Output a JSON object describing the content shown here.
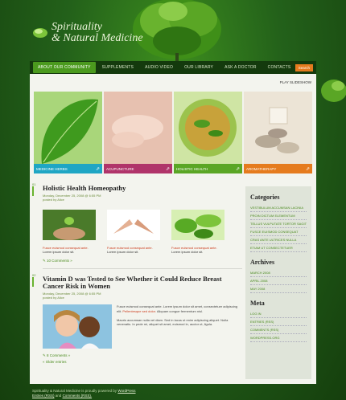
{
  "logo": {
    "line1": "Spirituality",
    "line2": "& Natural Medicine"
  },
  "nav": {
    "items": [
      {
        "label": "About Our Community",
        "active": true
      },
      {
        "label": "Supplements",
        "active": false
      },
      {
        "label": "Audio video",
        "active": false
      },
      {
        "label": "Our library",
        "active": false
      },
      {
        "label": "Ask a doctor",
        "active": false
      },
      {
        "label": "Contacts",
        "active": false
      }
    ],
    "search": "Search"
  },
  "slideshow": {
    "play": "Play slideshow"
  },
  "tiles": [
    {
      "label": "Medicine Herbs",
      "color": "#1fa6c4"
    },
    {
      "label": "Acupuncture",
      "color": "#b0346a"
    },
    {
      "label": "Holistic Health",
      "color": "#5aa625"
    },
    {
      "label": "Aromatherapy",
      "color": "#e57b1e"
    }
  ],
  "posts": [
    {
      "num": "01",
      "title": "Holistic Health Homeopathy",
      "date": "Monday, December 25, 2008 @ 6:55 PM",
      "author": "posted by Alice",
      "thumbs": [
        {
          "caption_red": "Fusce euismod consequat ante.",
          "caption": "Lorem ipsum dolor sit."
        },
        {
          "caption_red": "Fusce euismod consequat ante.",
          "caption": "Lorem ipsum dolor sit."
        },
        {
          "caption_red": "Fusce euismod consequat ante.",
          "caption": "Lorem ipsum dolor sit."
        }
      ],
      "comments": "10 Comments »"
    },
    {
      "num": "02",
      "title": "Vitamin D was Tested to See Whether it Could Reduce Breast Cancer Risk in Women",
      "date": "Monday, December 25, 2008 @ 6:55 PM",
      "author": "posted by Alice",
      "text_a": "Fusce euismod consequat ante. Lorem ipsum dolor sit amet, consectetuer adipiscing elit.",
      "text_red": "Pellentesque sed dolor.",
      "text_b": "Aliquam congue fermentum nisl.",
      "text_c": "Mauris accumsan nulla vel diam. Sed in lacus ut enim adipiscing aliquet. Nulla venenatis. In pede mi, aliquet sit amet, euismod in, auctor ut, ligula.",
      "comments": "8 Comments »",
      "older": "« Older entries"
    }
  ],
  "sidebar": {
    "categories_title": "Categories",
    "categories": [
      "Vestibulum accumsan lacinia",
      "Proin dictum elementum",
      "Tellus vulputate tortor sagittis",
      "Fusce euismod consequat",
      "Cras ante ultrices nulla",
      "Etiam ut consectetuer"
    ],
    "archives_title": "Archives",
    "archives": [
      "March 2008",
      "April 2008",
      "May 2008"
    ],
    "meta_title": "Meta",
    "meta": [
      "Log in",
      "Entries (RSS)",
      "Comments (RSS)",
      "WordPress.org"
    ]
  },
  "footer": {
    "line1_a": "Spirituality & Natural Medicine is proudly powered by",
    "line1_b": "WordPress",
    "line2_a": "Entries (RSS)",
    "line2_mid": "and",
    "line2_b": "Comments (RSS)."
  }
}
